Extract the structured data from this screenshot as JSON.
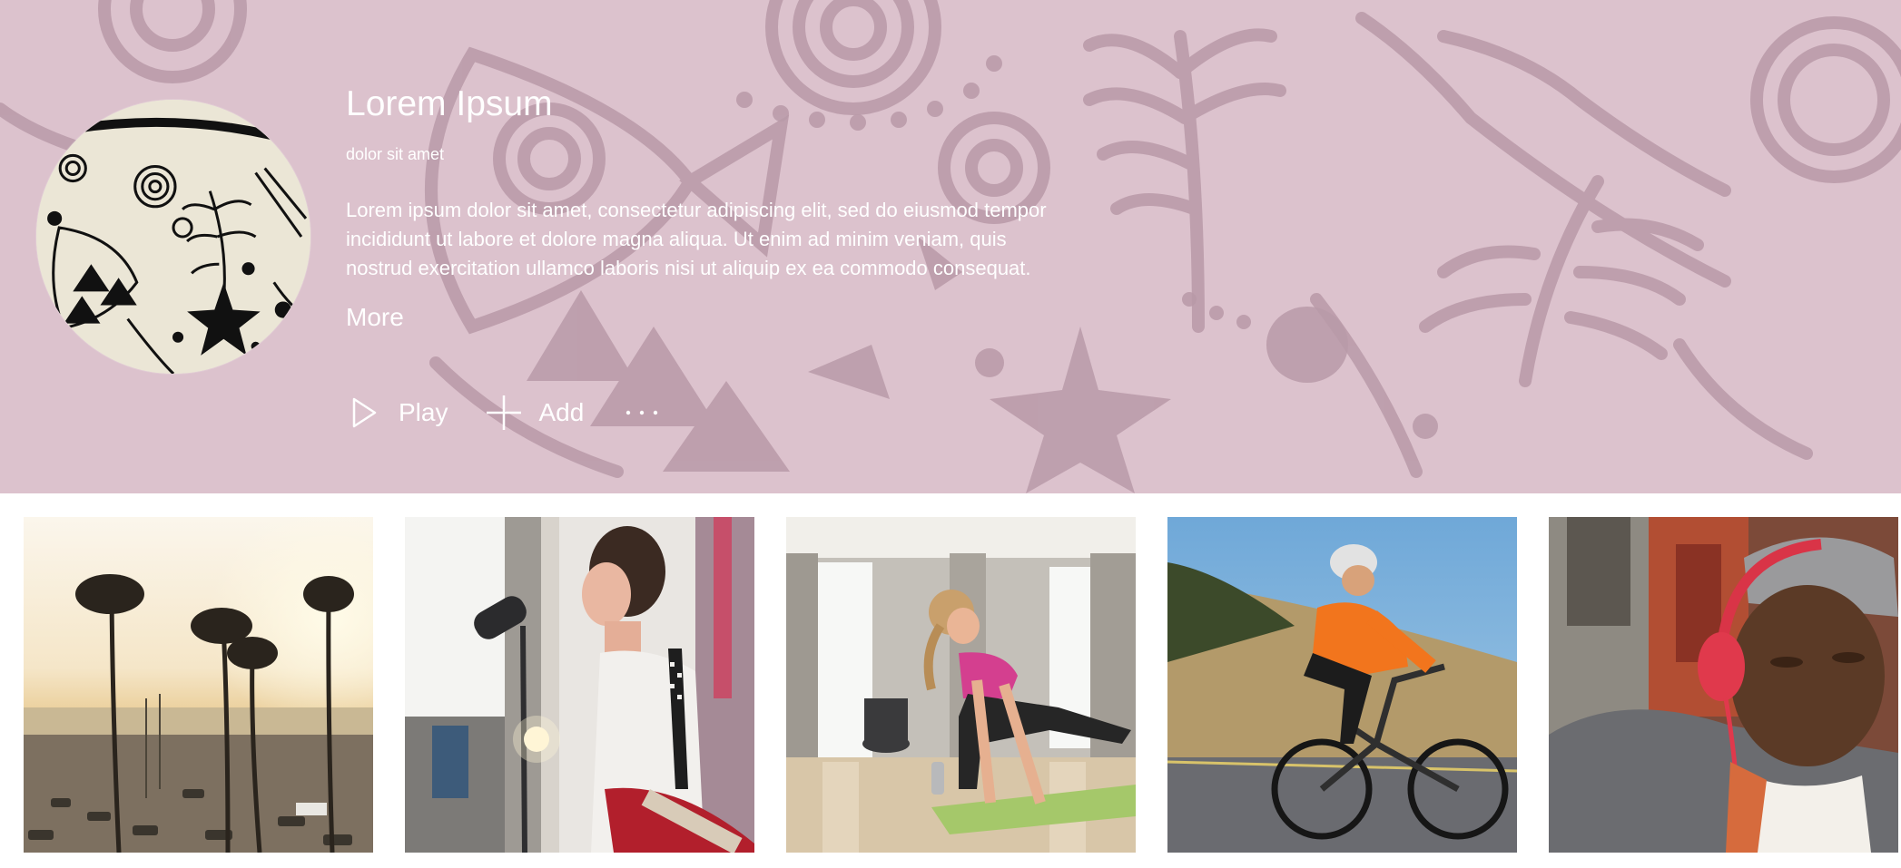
{
  "hero": {
    "title": "Lorem Ipsum",
    "subtitle": "dolor sit amet",
    "description": "Lorem ipsum dolor sit amet, consectetur adipiscing elit, sed do eiusmod tempor incididunt ut labore et dolore magna aliqua. Ut enim ad minim veniam, quis nostrud exercitation ullamco laboris nisi ut aliquip ex ea commodo consequat.",
    "more_label": "More",
    "background_color": "#dcc2cd",
    "pattern_color": "#b89aa8",
    "art_icon": "tribal-fish-pattern-art",
    "actions": {
      "play_label": "Play",
      "play_icon": "play-icon",
      "add_label": "Add",
      "add_icon": "plus-icon",
      "more_icon": "ellipsis-icon"
    }
  },
  "tiles": [
    {
      "subject": "palm-trees-sunset-parking-lot"
    },
    {
      "subject": "woman-singing-into-microphone-with-guitar"
    },
    {
      "subject": "woman-stretching-on-yoga-mat"
    },
    {
      "subject": "cyclist-in-orange-jersey-racing"
    },
    {
      "subject": "man-with-red-headphones-and-flat-cap"
    }
  ]
}
